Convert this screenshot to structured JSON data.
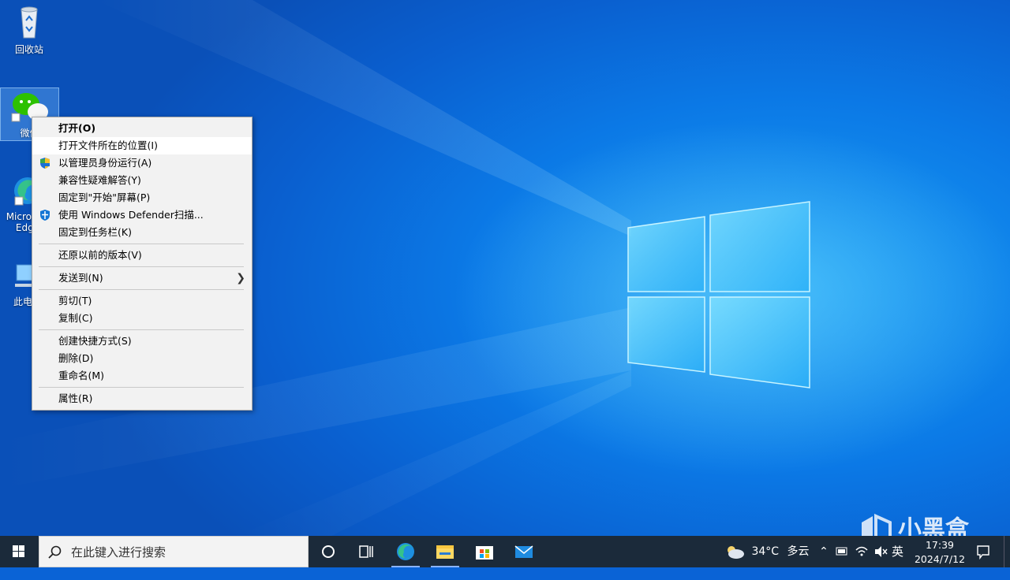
{
  "desktop": {
    "icons": [
      {
        "label": "回收站"
      },
      {
        "label": "微信"
      },
      {
        "label": "Microsoft Edge"
      },
      {
        "label": "此电脑"
      }
    ]
  },
  "context_menu": {
    "items": [
      {
        "label": "打开(O)",
        "bold": true
      },
      {
        "label": "打开文件所在的位置(I)",
        "hover": true
      },
      {
        "label": "以管理员身份运行(A)",
        "icon": "uac-shield-icon"
      },
      {
        "label": "兼容性疑难解答(Y)"
      },
      {
        "label": "固定到\"开始\"屏幕(P)"
      },
      {
        "label": "使用 Windows Defender扫描...",
        "icon": "defender-shield-icon"
      },
      {
        "label": "固定到任务栏(K)"
      },
      {
        "label": "还原以前的版本(V)"
      },
      {
        "label": "发送到(N)",
        "submenu": true
      },
      {
        "label": "剪切(T)"
      },
      {
        "label": "复制(C)"
      },
      {
        "label": "创建快捷方式(S)"
      },
      {
        "label": "删除(D)"
      },
      {
        "label": "重命名(M)"
      },
      {
        "label": "属性(R)"
      }
    ]
  },
  "taskbar": {
    "search_placeholder": "在此键入进行搜索",
    "apps": [
      "cortana-icon",
      "task-view-icon",
      "edge-icon",
      "file-explorer-icon",
      "store-icon",
      "mail-icon"
    ],
    "weather": {
      "temp": "34°C",
      "condition": "多云"
    },
    "ime": "英",
    "time": "17:39",
    "date": "2024/7/12"
  },
  "watermark": {
    "text": "小黑盒"
  },
  "colors": {
    "menu_bg": "#f2f2f2",
    "taskbar_bg": "#1b2a3a",
    "desktop_accent": "#0b79e6"
  }
}
